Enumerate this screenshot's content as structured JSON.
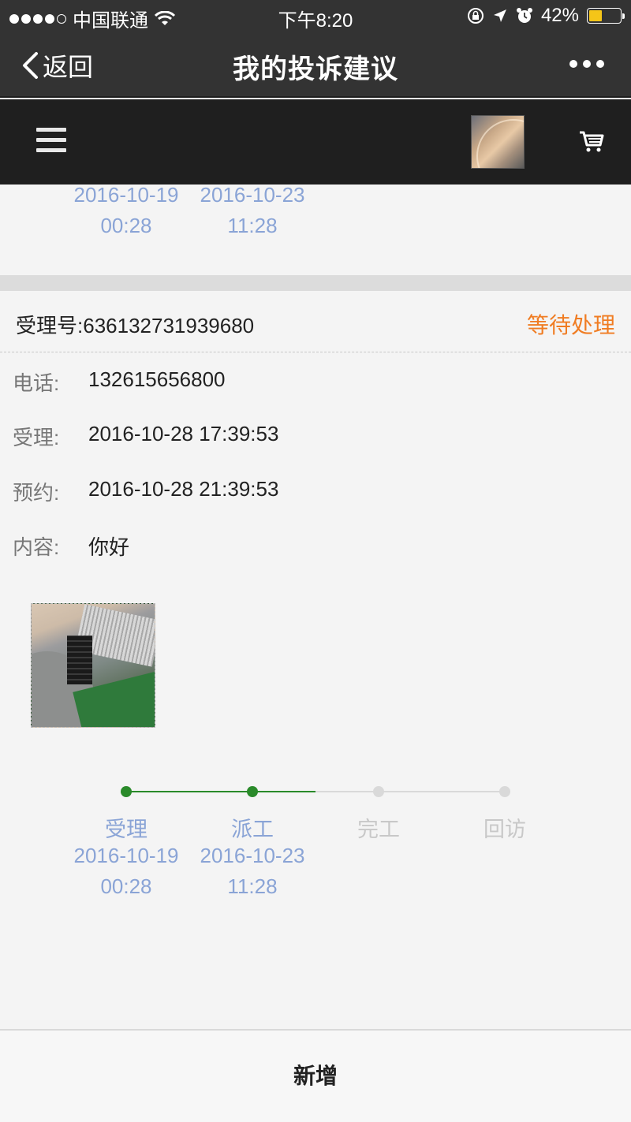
{
  "status_bar": {
    "carrier": "中国联通",
    "time": "下午8:20",
    "battery": "42%",
    "battery_level": 0.42,
    "signal_bars": 4,
    "signal_total": 5
  },
  "nav": {
    "back_label": "返回",
    "title": "我的投诉建议"
  },
  "previous_card": {
    "steps": [
      {
        "date": "2016-10-19",
        "time": "00:28"
      },
      {
        "date": "2016-10-23",
        "time": "11:28"
      }
    ]
  },
  "card": {
    "ticket_label": "受理号:",
    "ticket_number": "636132731939680",
    "status": "等待处理",
    "fields": [
      {
        "label": "电话:",
        "value": "132615656800"
      },
      {
        "label": "受理:",
        "value": "2016-10-28 17:39:53"
      },
      {
        "label": "预约:",
        "value": "2016-10-28 21:39:53"
      },
      {
        "label": "内容:",
        "value": "你好"
      }
    ],
    "progress": {
      "steps": [
        {
          "label": "受理",
          "date": "2016-10-19",
          "time": "00:28",
          "done": true
        },
        {
          "label": "派工",
          "date": "2016-10-23",
          "time": "11:28",
          "done": true
        },
        {
          "label": "完工",
          "date": "",
          "time": "",
          "done": false
        },
        {
          "label": "回访",
          "date": "",
          "time": "",
          "done": false
        }
      ]
    }
  },
  "bottom": {
    "add_label": "新增"
  },
  "colors": {
    "status_orange": "#f07c22",
    "done_green": "#2a8a2a",
    "pending_gray": "#d9d9d9",
    "date_blue": "#8aa4d6"
  }
}
